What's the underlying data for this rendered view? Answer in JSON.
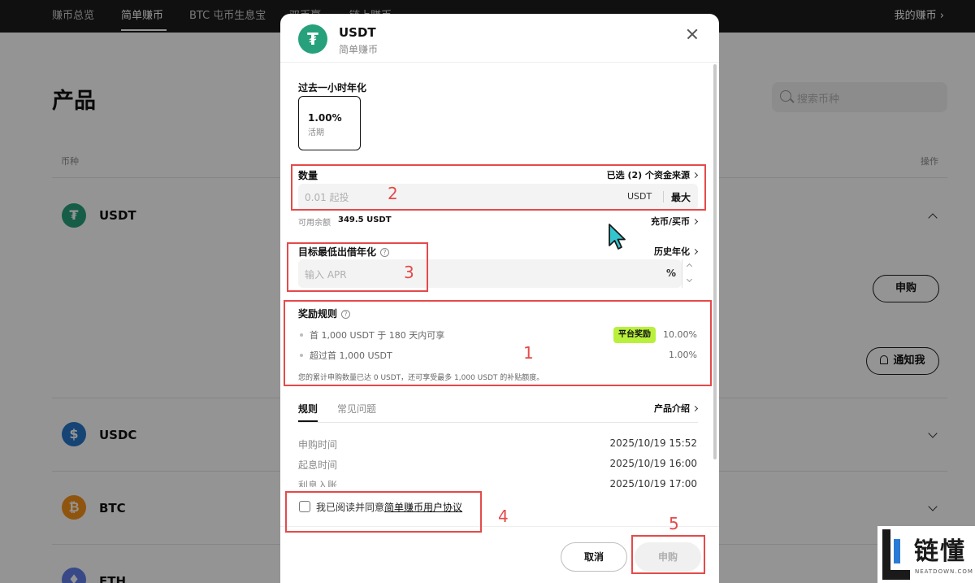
{
  "topnav": {
    "items": [
      "赚币总览",
      "简单赚币",
      "BTC 屯币生息宝",
      "双币赢",
      "链上赚币"
    ],
    "right": "我的赚币"
  },
  "page": {
    "title": "产品",
    "search_placeholder": "搜索币种",
    "col_coin": "币种",
    "col_action": "操作",
    "coins": [
      "USDT",
      "USDC",
      "BTC",
      "ETH"
    ],
    "subscribe_btn": "申购",
    "notify_btn": "通知我"
  },
  "modal": {
    "title": "USDT",
    "subtitle": "简单赚币",
    "apr_section_label": "过去一小时年化",
    "apr_value": "1.00%",
    "apr_type": "活期",
    "amount_label": "数量",
    "funding_source": "已选 (2) 个资金来源",
    "amount_placeholder": "0.01 起投",
    "amount_unit": "USDT",
    "max_label": "最大",
    "available_label": "可用余额",
    "available_value": "349.5 USDT",
    "deposit_buy": "充币/买币",
    "target_apr_label": "目标最低出借年化",
    "history_apr": "历史年化",
    "target_placeholder": "输入 APR",
    "percent_sign": "%",
    "reward_label": "奖励规则",
    "reward_rule1": "首 1,000 USDT 于 180 天内可享",
    "reward_badge": "平台奖励",
    "reward_pct1": "10.00%",
    "reward_rule2": "超过首 1,000 USDT",
    "reward_pct2": "1.00%",
    "reward_note": "您的累计申购数量已达 0 USDT，还可享受最多 1,000 USDT 的补贴额度。",
    "tab_rules": "规则",
    "tab_faq": "常见问题",
    "product_intro": "产品介绍",
    "info": [
      {
        "label": "申购时间",
        "value": "2025/10/19 15:52"
      },
      {
        "label": "起息时间",
        "value": "2025/10/19 16:00"
      },
      {
        "label": "利息入账",
        "value": "2025/10/19 17:00"
      }
    ],
    "agree_prefix": "我已阅读并同意",
    "agree_link": "简单赚币用户协议",
    "cancel": "取消",
    "subscribe": "申购"
  },
  "annotations": [
    "1",
    "2",
    "3",
    "4",
    "5"
  ],
  "watermark": {
    "text": "链懂",
    "sub": "NEATDOWN.COM"
  },
  "colors": {
    "usdt": "#26a17b",
    "usdc": "#2775ca",
    "btc": "#f7931a",
    "eth": "#627eea",
    "badge": "#b8f03b",
    "annotation": "#e54a4a",
    "cursor": "#34c6cf"
  }
}
